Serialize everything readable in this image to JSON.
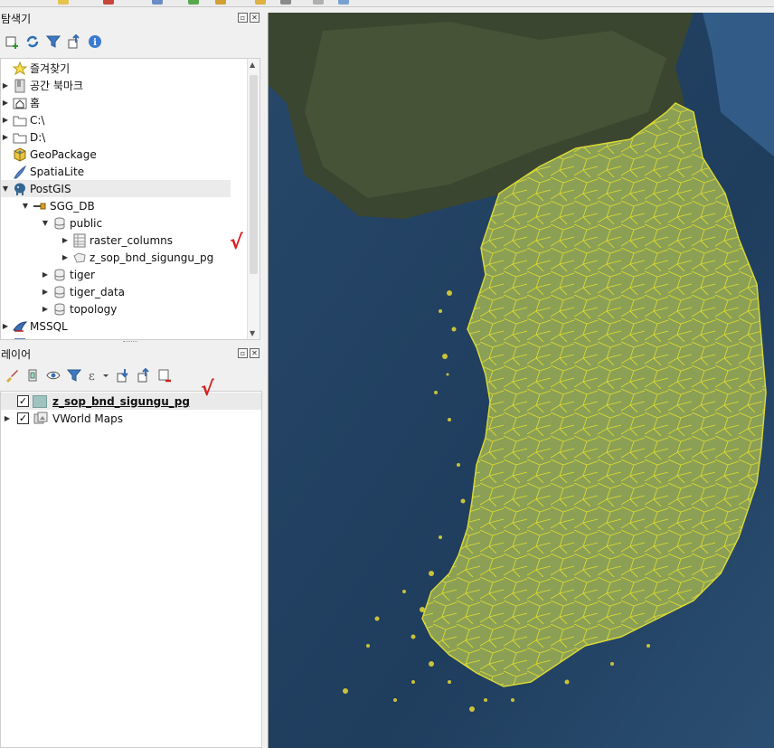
{
  "browser": {
    "title": "탐색기",
    "items": [
      {
        "label": "즐겨찾기",
        "icon": "star-icon"
      },
      {
        "label": "공간 북마크",
        "icon": "bookmark-icon"
      },
      {
        "label": "홈",
        "icon": "home-folder-icon"
      },
      {
        "label": "C:\\",
        "icon": "folder-icon"
      },
      {
        "label": "D:\\",
        "icon": "folder-icon"
      },
      {
        "label": "GeoPackage",
        "icon": "geopackage-icon"
      },
      {
        "label": "SpatiaLite",
        "icon": "spatialite-icon"
      },
      {
        "label": "PostGIS",
        "icon": "postgis-elephant-icon"
      },
      {
        "label": "SGG_DB",
        "icon": "connection-icon"
      },
      {
        "label": "public",
        "icon": "schema-icon"
      },
      {
        "label": "raster_columns",
        "icon": "table-icon"
      },
      {
        "label": "z_sop_bnd_sigungu_pg",
        "icon": "polygon-layer-icon"
      },
      {
        "label": "tiger",
        "icon": "schema-icon"
      },
      {
        "label": "tiger_data",
        "icon": "schema-icon"
      },
      {
        "label": "topology",
        "icon": "schema-icon"
      },
      {
        "label": "MSSQL",
        "icon": "mssql-icon"
      }
    ]
  },
  "layers": {
    "title": "레이어",
    "items": [
      {
        "label": "z_sop_bnd_sigungu_pg",
        "checked": true,
        "swatch_color": "#9fc4c0"
      },
      {
        "label": "VWorld Maps",
        "checked": true
      }
    ]
  },
  "annotation": {
    "mark": "√"
  },
  "colors": {
    "boundary": "#e3de2e",
    "sea": "#22456a",
    "annotation": "#d81e1e"
  }
}
